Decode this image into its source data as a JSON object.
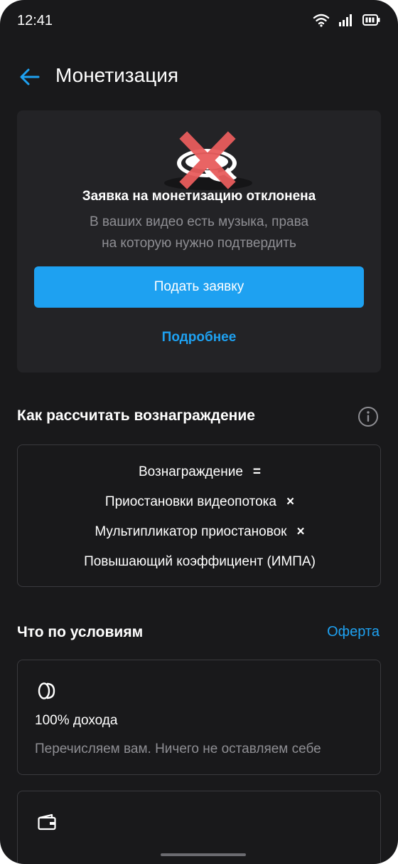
{
  "status_bar": {
    "time": "12:41"
  },
  "header": {
    "title": "Монетизация"
  },
  "rejection_card": {
    "title": "Заявка на монетизацию отклонена",
    "desc_line1": "В ваших видео есть музыка, права",
    "desc_line2": "на которую нужно подтвердить",
    "apply_button": "Подать заявку",
    "more_link": "Подробнее"
  },
  "reward": {
    "section_title": "Как рассчитать вознаграждение",
    "line1": "Вознаграждение",
    "op1": "=",
    "line2": "Приостановки видеопотока",
    "op2": "×",
    "line3": "Мультипликатор приостановок",
    "op3": "×",
    "line4": "Повышающий коэффициент (ИМПА)"
  },
  "conditions": {
    "section_title": "Что по условиям",
    "offer_link": "Оферта",
    "items": [
      {
        "icon": "coins-icon",
        "title": "100% дохода",
        "desc": "Перечисляем вам. Ничего не оставляем себе"
      },
      {
        "icon": "wallet-icon"
      }
    ]
  },
  "colors": {
    "accent": "#1ea1f1",
    "background": "#19191b",
    "card": "#232326",
    "reject": "#e85c5c"
  }
}
